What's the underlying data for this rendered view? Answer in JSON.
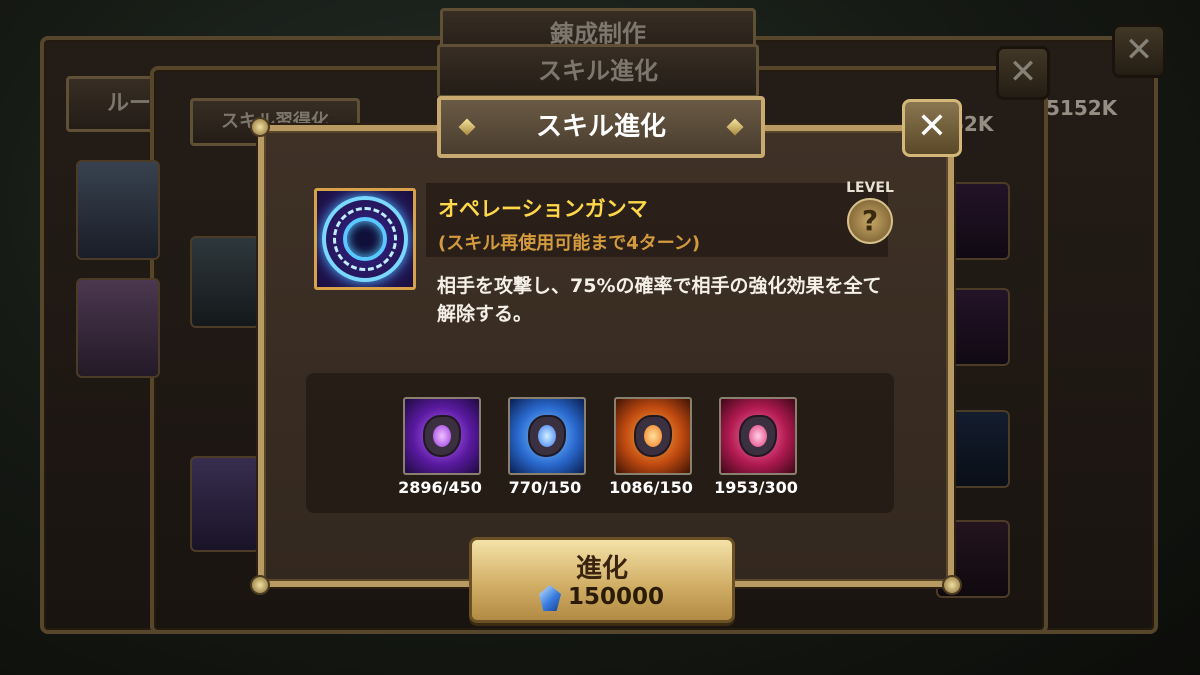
{
  "background": {
    "header_tabs": [
      "錬成制作",
      "スキル進化"
    ],
    "left_tab": "ルー",
    "sub_tab": "スキル習得化",
    "resource_partial": "52K",
    "resource_right": "5152K"
  },
  "dialog": {
    "title": "スキル進化",
    "close_label": "✕",
    "level_label": "LEVEL",
    "level_help": "?",
    "skill": {
      "name": "オペレーションガンマ",
      "cooldown": "(スキル再使用可能まで4ターン)",
      "description": "相手を攻撃し、75%の確率で相手の強化効果を全て解除する。"
    },
    "materials": [
      {
        "icon": "purple-essence-icon",
        "quantity": "2896/450",
        "color": "#8a3ae0"
      },
      {
        "icon": "blue-essence-icon",
        "quantity": "770/150",
        "color": "#3a7af0"
      },
      {
        "icon": "orange-essence-icon",
        "quantity": "1086/150",
        "color": "#f07a1a"
      },
      {
        "icon": "pink-essence-icon",
        "quantity": "1953/300",
        "color": "#e03a7a"
      }
    ],
    "evolve_button": {
      "label": "進化",
      "cost": "150000",
      "cost_icon": "crystal-icon"
    }
  }
}
